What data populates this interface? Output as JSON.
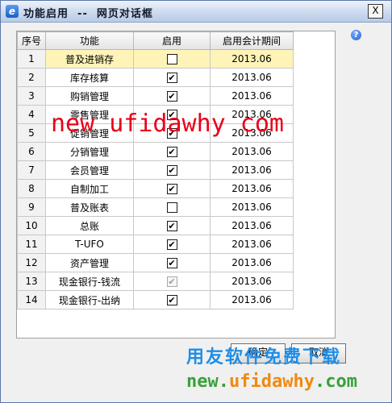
{
  "window": {
    "title": "功能启用  --  网页对话框",
    "icon": "ie-icon",
    "close_label": "X",
    "help_label": "?"
  },
  "table": {
    "headers": [
      "序号",
      "功能",
      "启用",
      "启用会计期间"
    ],
    "rows": [
      {
        "no": "1",
        "name": "普及进销存",
        "enabled": false,
        "disabled": false,
        "period": "2013.06",
        "selected": true
      },
      {
        "no": "2",
        "name": "库存核算",
        "enabled": true,
        "disabled": false,
        "period": "2013.06"
      },
      {
        "no": "3",
        "name": "购销管理",
        "enabled": true,
        "disabled": false,
        "period": "2013.06"
      },
      {
        "no": "4",
        "name": "零售管理",
        "enabled": true,
        "disabled": false,
        "period": "2013.06"
      },
      {
        "no": "5",
        "name": "促销管理",
        "enabled": true,
        "disabled": false,
        "period": "2013.06"
      },
      {
        "no": "6",
        "name": "分销管理",
        "enabled": true,
        "disabled": false,
        "period": "2013.06"
      },
      {
        "no": "7",
        "name": "会员管理",
        "enabled": true,
        "disabled": false,
        "period": "2013.06"
      },
      {
        "no": "8",
        "name": "自制加工",
        "enabled": true,
        "disabled": false,
        "period": "2013.06"
      },
      {
        "no": "9",
        "name": "普及账表",
        "enabled": false,
        "disabled": false,
        "period": "2013.06"
      },
      {
        "no": "10",
        "name": "总账",
        "enabled": true,
        "disabled": false,
        "period": "2013.06"
      },
      {
        "no": "11",
        "name": "T-UFO",
        "enabled": true,
        "disabled": false,
        "period": "2013.06"
      },
      {
        "no": "12",
        "name": "资产管理",
        "enabled": true,
        "disabled": false,
        "period": "2013.06"
      },
      {
        "no": "13",
        "name": "现金银行-钱流",
        "enabled": true,
        "disabled": true,
        "period": "2013.06"
      },
      {
        "no": "14",
        "name": "现金银行-出纳",
        "enabled": true,
        "disabled": false,
        "period": "2013.06"
      }
    ]
  },
  "buttons": {
    "ok": "确定",
    "cancel": "取消"
  },
  "watermarks": {
    "top": "new ufidawhy com",
    "line1": "用友软件免费下载",
    "line2_a": "new.",
    "line2_b": "ufidawhy",
    "line2_c": ".com"
  },
  "colors": {
    "selected_row": "#fff4b8",
    "watermark_red": "#e8001a",
    "watermark_blue": "#1e8ee8",
    "watermark_green": "#3aa13a"
  }
}
